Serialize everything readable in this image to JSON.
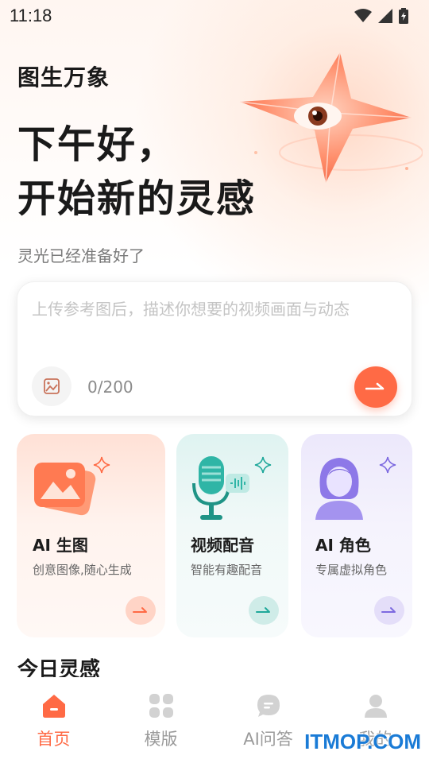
{
  "status": {
    "time": "11:18"
  },
  "header": {
    "brand": "图生万象",
    "greeting_line1": "下午好，",
    "greeting_line2": "开始新的灵感",
    "subtitle": "灵光已经准备好了"
  },
  "prompt": {
    "placeholder": "上传参考图后，描述你想要的视频画面与动态",
    "value": "",
    "counter": "0/200"
  },
  "features": [
    {
      "title": "AI 生图",
      "desc": "创意图像,随心生成",
      "accent": "#ff6a45"
    },
    {
      "title": "视频配音",
      "desc": "智能有趣配音",
      "accent": "#1fa89a"
    },
    {
      "title": "AI 角色",
      "desc": "专属虚拟角色",
      "accent": "#7d6ae0"
    }
  ],
  "section": {
    "title": "今日灵感"
  },
  "tabs": [
    {
      "label": "首页",
      "icon": "home-icon",
      "active": true
    },
    {
      "label": "模版",
      "icon": "grid-icon",
      "active": false
    },
    {
      "label": "AI问答",
      "icon": "chat-icon",
      "active": false
    },
    {
      "label": "我的",
      "icon": "user-icon",
      "active": false
    }
  ],
  "watermark": "ITMOP.COM",
  "colors": {
    "accent": "#ff6a45",
    "inactive": "#9a9a9a"
  }
}
